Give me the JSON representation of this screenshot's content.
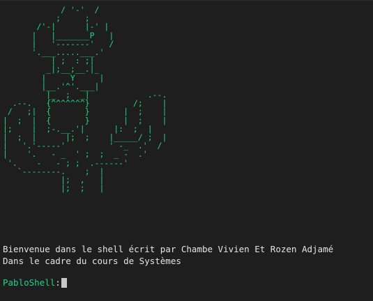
{
  "terminal": {
    "ascii_art": "            / '-'  /\n           ;     ;\n       /'-|      |-' |\n      |   |_______P   |\n      |   '-------'   /\n      '.___.....___.'\n          | ;  : ;|\n         _|;__;__.|_\n        |     Y     |\n        |__.'^'.___|\n         |_  ;  _|            .--.\n  .--.   {^^^^^^^}         /;    |\n /   ;|  {       }       |  ;    |\n|  ;  |  {       }       |  ;    |\n|;    |  ;-.__.'|      |:  ;  |\n|  ;  |      |;  ;    |_____/ ;  |\n|   '.'-----'         ' -_  .'  /\n|    '.   - _  ' ;  ;  _ -  .'\n '.    -   - ; ;  .------'\n   `--------.    ;  |\n            |;  ,   |\n            |;  ;   |",
    "welcome_line1": "Bienvenue dans le shell écrit par Chambe Vivien Et Rozen Adjamé",
    "welcome_line2": "Dans le cadre du cours de Systèmes",
    "prompt_name": "PabloShell",
    "prompt_separator": ":",
    "input_value": ""
  },
  "colors": {
    "background": "#1e1e1e",
    "accent_green": "#23d18b",
    "text": "#e5e5e5",
    "cursor": "#c8c8c8"
  }
}
